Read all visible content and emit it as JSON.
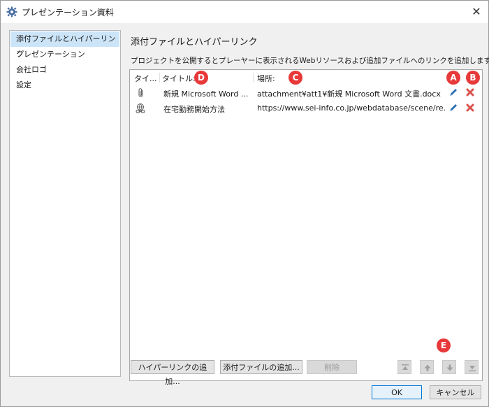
{
  "window": {
    "title": "プレゼンテーション資料",
    "title_icon": "gear-icon",
    "close_icon": "close-icon",
    "close_glyph": "✕"
  },
  "sidebar": {
    "items": [
      {
        "label": "添付ファイルとハイパーリンク",
        "selected": true
      },
      {
        "label": "プレゼンテーション",
        "selected": false
      },
      {
        "label": "会社ロゴ",
        "selected": false
      },
      {
        "label": "設定",
        "selected": false
      }
    ]
  },
  "panel": {
    "title": "添付ファイルとハイパーリンク",
    "description": "プロジェクトを公開するとプレーヤーに表示されるWebリソースおよび追加ファイルへのリンクを追加します。"
  },
  "list": {
    "columns": {
      "type": "タイ...",
      "title": "タイトル:",
      "location": "場所:"
    },
    "rows": [
      {
        "type_icon": "paperclip-icon",
        "title": "新規 Microsoft Word ...",
        "location": "attachment¥att1¥新規 Microsoft Word 文書.docx",
        "edit_icon": "pencil-icon",
        "delete_icon": "delete-icon"
      },
      {
        "type_icon": "link-icon",
        "title": "在宅勤務開始方法",
        "location": "https://www.sei-info.co.jp/webdatabase/scene/re...",
        "edit_icon": "pencil-icon",
        "delete_icon": "delete-icon"
      }
    ]
  },
  "markers": {
    "a": "A",
    "b": "B",
    "c": "C",
    "d": "D",
    "e": "E"
  },
  "buttons": {
    "add_hyperlink": "ハイパーリンクの追加...",
    "add_attachment": "添付ファイルの追加...",
    "delete": "削除",
    "ok": "OK",
    "cancel": "キャンセル",
    "move_top_icon": "move-top-icon",
    "move_up_icon": "move-up-icon",
    "move_down_icon": "move-down-icon",
    "move_bottom_icon": "move-bottom-icon"
  },
  "colors": {
    "accent": "#0078d7",
    "marker": "#e8393a",
    "pencil": "#2b6cb0",
    "delete": "#d9534f",
    "selection": "#cce4f7"
  }
}
